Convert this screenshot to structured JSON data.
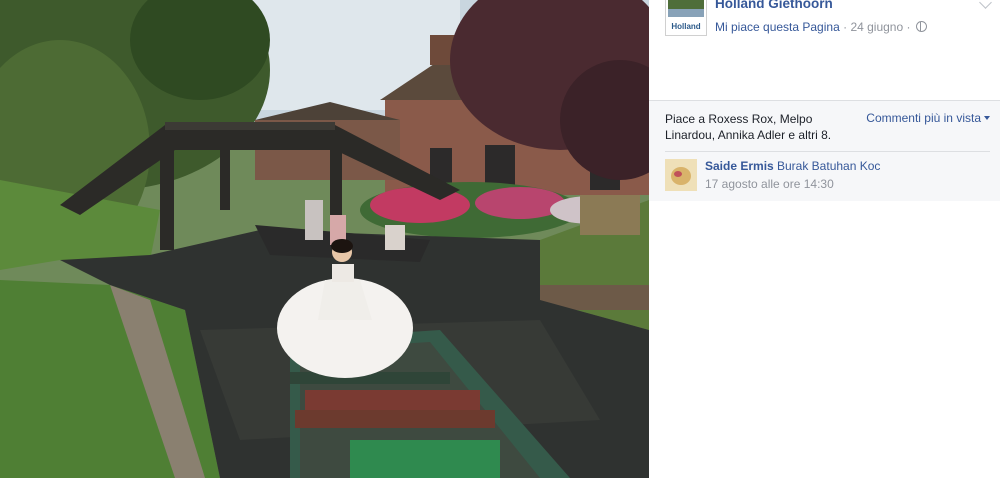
{
  "post": {
    "page_name": "Holland Giethoorn",
    "page_avatar_text": "Holland",
    "like_page_link": "Mi piace questa Pagina",
    "separator": "·",
    "date": "24 giugno",
    "privacy_icon": "globe-icon",
    "menu_icon": "chevron-down-icon"
  },
  "likes": {
    "text": "Piace a Roxess Rox, Melpo Linardou, Annika Adler e altri 8.",
    "sort_label": "Commenti più in vista"
  },
  "comments": [
    {
      "author": "Saide Ermis",
      "text": "Burak Batuhan Koc",
      "time": "17 agosto alle ore 14:30"
    }
  ],
  "colors": {
    "link": "#365899",
    "muted": "#90949c",
    "likes_bg": "#f6f7f9"
  }
}
